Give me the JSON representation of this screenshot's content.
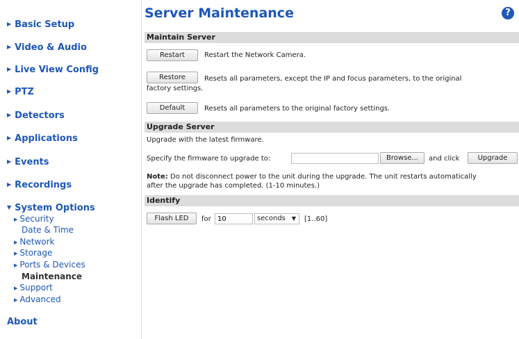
{
  "sidebar": {
    "items": [
      {
        "label": "Basic Setup"
      },
      {
        "label": "Video & Audio"
      },
      {
        "label": "Live View Config"
      },
      {
        "label": "PTZ"
      },
      {
        "label": "Detectors"
      },
      {
        "label": "Applications"
      },
      {
        "label": "Events"
      },
      {
        "label": "Recordings"
      },
      {
        "label": "System Options"
      }
    ],
    "system_options_children": [
      {
        "label": "Security"
      },
      {
        "label": "Date & Time"
      },
      {
        "label": "Network"
      },
      {
        "label": "Storage"
      },
      {
        "label": "Ports & Devices"
      },
      {
        "label": "Maintenance"
      },
      {
        "label": "Support"
      },
      {
        "label": "Advanced"
      }
    ],
    "about": "About"
  },
  "page": {
    "title": "Server Maintenance",
    "help_icon": "help-icon",
    "help_glyph": "?"
  },
  "maintain": {
    "header": "Maintain Server",
    "restart_label": "Restart",
    "restart_desc": "Restart the Network Camera.",
    "restore_label": "Restore",
    "restore_desc_line1": "Resets all parameters, except the IP and focus parameters, to the original",
    "restore_desc_line2": "factory settings.",
    "default_label": "Default",
    "default_desc": "Resets all parameters to the original factory settings."
  },
  "upgrade": {
    "header": "Upgrade Server",
    "intro": "Upgrade with the latest firmware.",
    "specify_label": "Specify the firmware to upgrade to:",
    "file_value": "",
    "browse_label": "Browse...",
    "and_click": "and click",
    "upgrade_label": "Upgrade",
    "note_bold": "Note:",
    "note_line1": " Do not disconnect power to the unit during the upgrade. The unit restarts automatically",
    "note_line2": "after the upgrade has completed. (1-10 minutes.)"
  },
  "identify": {
    "header": "Identify",
    "flash_label": "Flash LED",
    "for_label": "for",
    "duration_value": "10",
    "unit_selected": "seconds",
    "range_label": "[1..60]"
  },
  "colors": {
    "link": "#1e57b8",
    "section_bg": "#dcdcdc"
  }
}
